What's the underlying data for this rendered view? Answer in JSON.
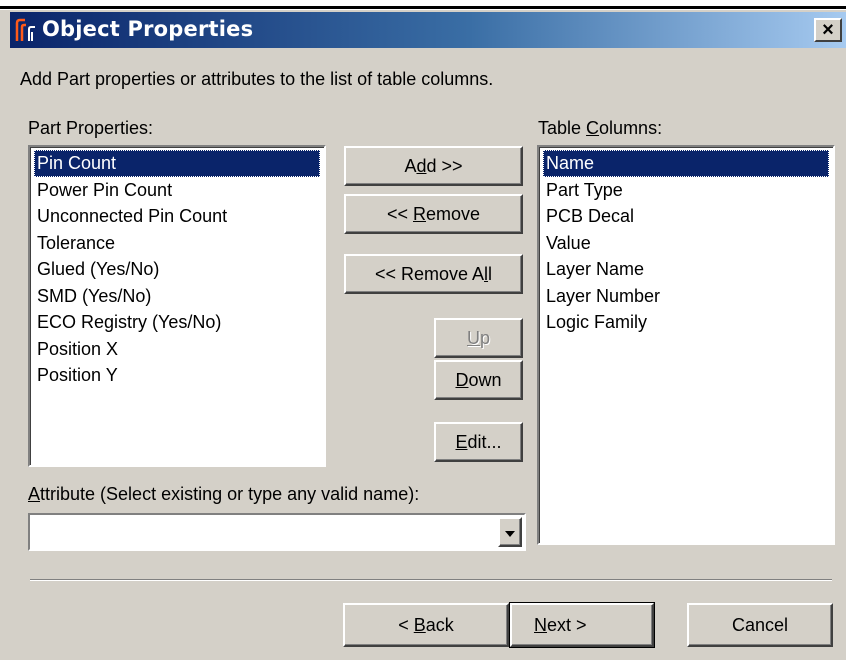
{
  "window": {
    "title": "Object Properties",
    "close_glyph": "×"
  },
  "instruction": "Add Part properties or attributes to the list of table columns.",
  "part_properties": {
    "label": "Part Properties:",
    "items": [
      "Pin Count",
      "Power Pin Count",
      "Unconnected Pin Count",
      "Tolerance",
      "Glued (Yes/No)",
      "SMD (Yes/No)",
      "ECO Registry (Yes/No)",
      "Position X",
      "Position Y"
    ],
    "selected_index": 0
  },
  "table_columns": {
    "label_pre": "Table ",
    "label_key": "C",
    "label_post": "olumns:",
    "items": [
      "Name",
      "Part Type",
      "PCB Decal",
      "Value",
      "Layer Name",
      "Layer Number",
      "Logic Family"
    ],
    "selected_index": 0
  },
  "buttons": {
    "add": {
      "pre": "A",
      "key": "d",
      "post": "d >>"
    },
    "remove": {
      "pre": "<< ",
      "key": "R",
      "post": "emove"
    },
    "remove_all": {
      "pre": "<< Remove A",
      "key": "l",
      "post": "l"
    },
    "up": {
      "pre": "",
      "key": "U",
      "post": "p"
    },
    "down": {
      "pre": "",
      "key": "D",
      "post": "own"
    },
    "edit": {
      "pre": "",
      "key": "E",
      "post": "dit..."
    }
  },
  "attribute": {
    "label_key": "A",
    "label_post": "ttribute (Select existing or type any valid name):",
    "value": ""
  },
  "footer": {
    "back": {
      "pre": "< ",
      "key": "B",
      "post": "ack"
    },
    "next": {
      "pre": "",
      "key": "N",
      "post": "ext >"
    },
    "cancel": "Cancel"
  },
  "colors": {
    "dialog_bg": "#d4d0c8",
    "selection": "#0a246a",
    "title_start": "#0a246a",
    "title_end": "#a6caf0"
  }
}
